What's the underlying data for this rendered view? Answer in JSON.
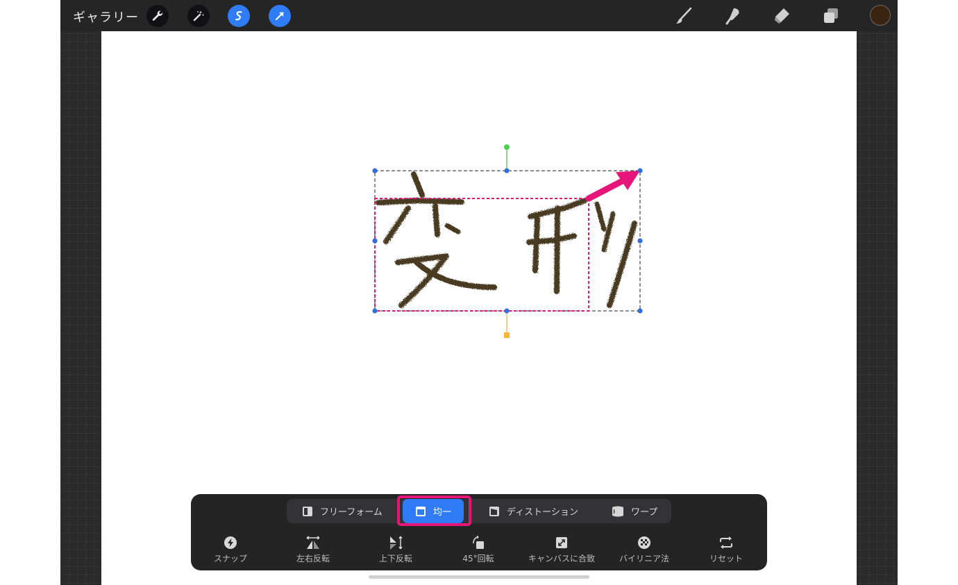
{
  "topbar": {
    "gallery_label": "ギャラリー",
    "left_tools": [
      {
        "icon": "wrench-icon"
      },
      {
        "icon": "magic-wand-icon"
      },
      {
        "icon": "selection-icon",
        "active": true
      },
      {
        "icon": "transform-arrow-icon",
        "active": true
      }
    ],
    "right_tools": [
      {
        "icon": "brush-icon"
      },
      {
        "icon": "smudge-icon"
      },
      {
        "icon": "eraser-icon"
      },
      {
        "icon": "layers-icon"
      }
    ],
    "current_color": "#3b2410"
  },
  "canvas": {
    "drawing_text": "変形",
    "stroke_color": "#4a3a22",
    "annotation_color": "#e5157a",
    "handle_color": "#2f6fe0"
  },
  "transform_panel": {
    "modes": [
      {
        "label": "フリーフォーム",
        "icon": "freeform-icon"
      },
      {
        "label": "均一",
        "icon": "uniform-icon",
        "active": true
      },
      {
        "label": "ディストーション",
        "icon": "distort-icon"
      },
      {
        "label": "ワープ",
        "icon": "warp-icon"
      }
    ],
    "tools": [
      {
        "label": "スナップ",
        "icon": "snap-icon"
      },
      {
        "label": "左右反転",
        "icon": "flip-horizontal-icon"
      },
      {
        "label": "上下反転",
        "icon": "flip-vertical-icon"
      },
      {
        "label": "45°回転",
        "icon": "rotate-45-icon"
      },
      {
        "label": "キャンバスに合致",
        "icon": "fit-to-canvas-icon"
      },
      {
        "label": "バイリニア法",
        "icon": "bilinear-icon"
      },
      {
        "label": "リセット",
        "icon": "reset-icon"
      }
    ],
    "accent_color": "#2f7cf6"
  }
}
